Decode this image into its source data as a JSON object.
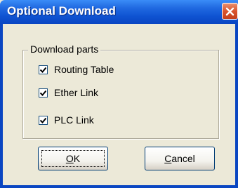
{
  "window": {
    "title": "Optional Download"
  },
  "group": {
    "legend": "Download parts",
    "items": [
      {
        "label": "Routing Table",
        "checked": true
      },
      {
        "label": "Ether Link",
        "checked": true
      },
      {
        "label": "PLC Link",
        "checked": true
      }
    ]
  },
  "buttons": {
    "ok_mnemonic": "O",
    "ok_rest": "K",
    "cancel_mnemonic": "C",
    "cancel_rest": "ancel"
  },
  "icons": {
    "close": "close-icon",
    "check": "checkmark-icon"
  },
  "colors": {
    "titlebar": "#0a46c2",
    "close": "#d9542e",
    "dialog_bg": "#ece9d8"
  }
}
